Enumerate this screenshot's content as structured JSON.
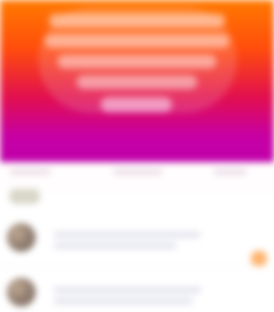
{
  "hero": {
    "line_1": "",
    "line_2": "",
    "line_3": "",
    "line_4": "",
    "cta": ""
  },
  "tabs": [
    {
      "label": ""
    },
    {
      "label": ""
    },
    {
      "label": ""
    }
  ],
  "feed": {
    "items": [
      {
        "title": "",
        "subtitle": ""
      },
      {
        "title": "",
        "subtitle": ""
      }
    ]
  }
}
